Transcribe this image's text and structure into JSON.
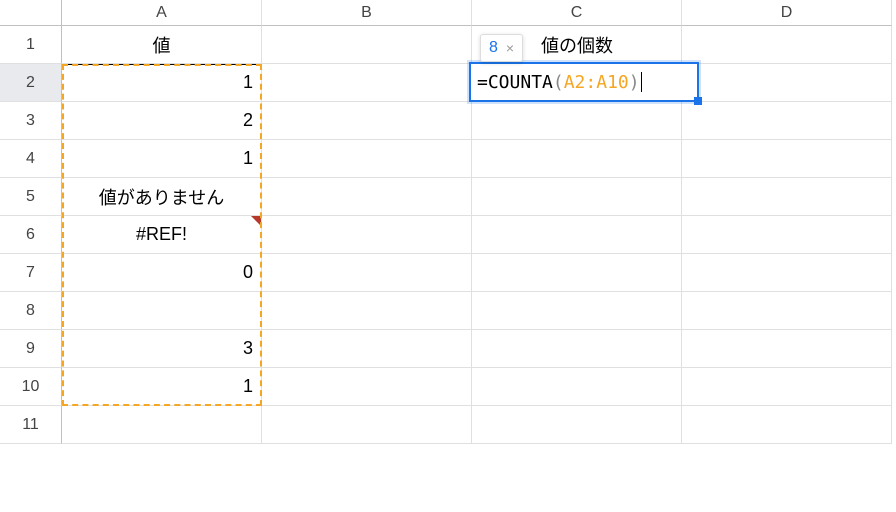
{
  "columns": [
    "A",
    "B",
    "C",
    "D"
  ],
  "rows": [
    "1",
    "2",
    "3",
    "4",
    "5",
    "6",
    "7",
    "8",
    "9",
    "10",
    "11"
  ],
  "headerA": "値",
  "headerC": "値の個数",
  "columnA_values": {
    "2": "1",
    "3": "2",
    "4": "1",
    "5": "値がありません",
    "6": "#REF!",
    "7": "0",
    "8": "",
    "9": "3",
    "10": "1"
  },
  "columnA_align": {
    "2": "num",
    "3": "num",
    "4": "num",
    "5": "center",
    "6": "center",
    "7": "num",
    "8": "num",
    "9": "num",
    "10": "num"
  },
  "formula": {
    "eq": "=",
    "fn": "COUNTA",
    "open": "(",
    "range": "A2:A10",
    "close": ")"
  },
  "preview": {
    "value": "8",
    "close": "×"
  },
  "chart_data": {
    "type": "table",
    "title": "",
    "columns": [
      "値"
    ],
    "rows": [
      [
        "1"
      ],
      [
        "2"
      ],
      [
        "1"
      ],
      [
        "値がありません"
      ],
      [
        "#REF!"
      ],
      [
        "0"
      ],
      [
        ""
      ],
      [
        "3"
      ],
      [
        "1"
      ]
    ],
    "computed": {
      "label": "値の個数",
      "formula": "=COUNTA(A2:A10)",
      "result": 8
    }
  }
}
